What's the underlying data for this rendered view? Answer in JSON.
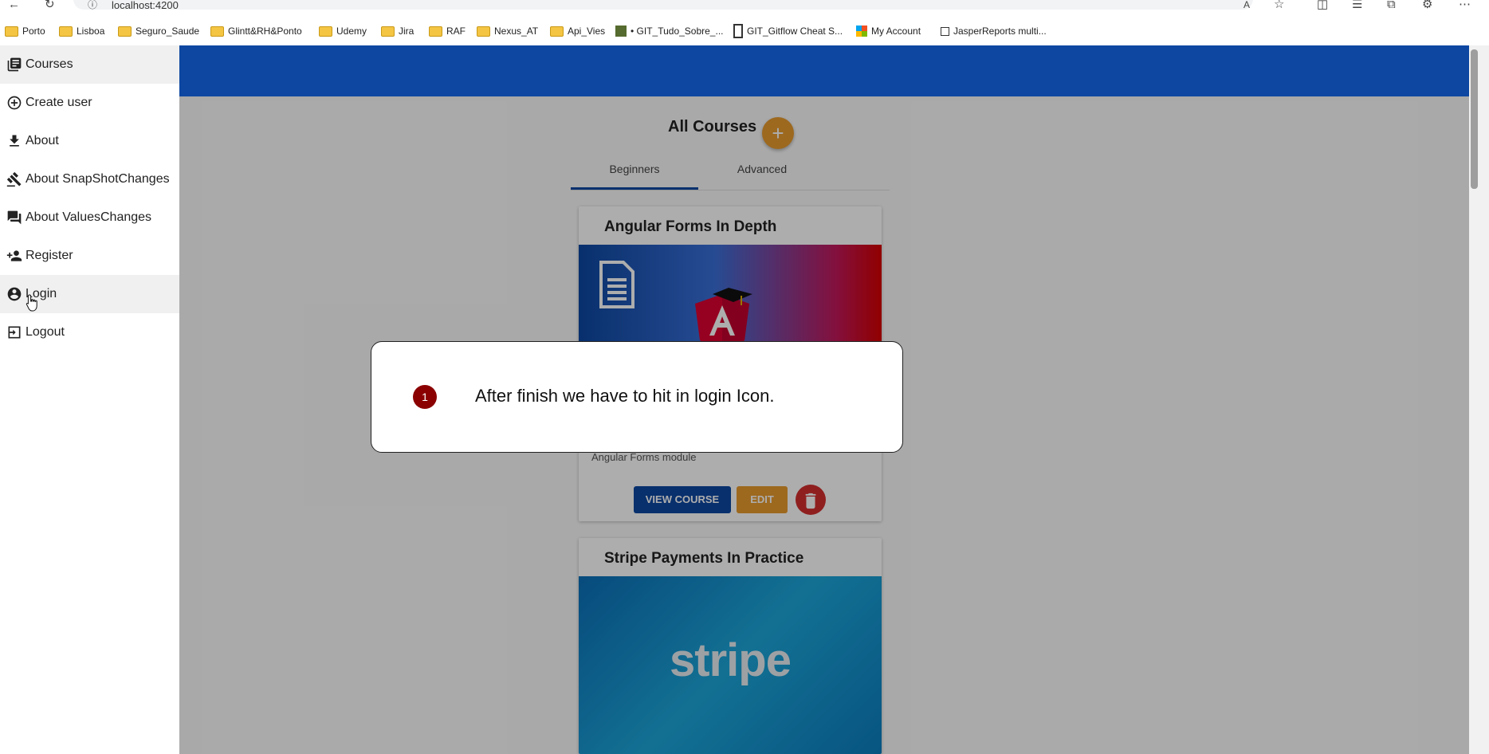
{
  "browser": {
    "url": "localhost:4200",
    "bookmarks": [
      {
        "label": "Porto",
        "kind": "folder"
      },
      {
        "label": "Lisboa",
        "kind": "folder"
      },
      {
        "label": "Seguro_Saude",
        "kind": "folder"
      },
      {
        "label": "Glintt&RH&Ponto",
        "kind": "folder"
      },
      {
        "label": "Udemy",
        "kind": "folder"
      },
      {
        "label": "Jira",
        "kind": "folder"
      },
      {
        "label": "RAF",
        "kind": "folder"
      },
      {
        "label": "Nexus_AT",
        "kind": "folder"
      },
      {
        "label": "Api_Vies",
        "kind": "folder"
      },
      {
        "label": "• GIT_Tudo_Sobre_...",
        "kind": "page"
      },
      {
        "label": "GIT_Gitflow Cheat S...",
        "kind": "page"
      },
      {
        "label": "My Account",
        "kind": "page"
      },
      {
        "label": "JasperReports multi...",
        "kind": "page"
      }
    ]
  },
  "sidebar": {
    "items": [
      {
        "label": "Courses",
        "icon": "library-books-icon"
      },
      {
        "label": "Create user",
        "icon": "add-circle-icon"
      },
      {
        "label": "About",
        "icon": "download-icon"
      },
      {
        "label": "About SnapShotChanges",
        "icon": "gavel-icon"
      },
      {
        "label": "About ValuesChanges",
        "icon": "forum-icon"
      },
      {
        "label": "Register",
        "icon": "person-add-icon"
      },
      {
        "label": "Login",
        "icon": "account-circle-icon"
      },
      {
        "label": "Logout",
        "icon": "exit-icon"
      }
    ]
  },
  "main": {
    "title": "All Courses",
    "add_button": "+",
    "tabs": [
      {
        "label": "Beginners",
        "active": true
      },
      {
        "label": "Advanced",
        "active": false
      }
    ],
    "courses": [
      {
        "title": "Angular Forms In Depth",
        "description": "Angular Forms module",
        "view_label": "VIEW COURSE",
        "edit_label": "EDIT"
      },
      {
        "title": "Stripe Payments In Practice",
        "image_text": "stripe"
      }
    ]
  },
  "callout": {
    "number": "1",
    "text": "After finish we have to hit in login Icon."
  },
  "colors": {
    "primary": "#0d47a1",
    "accent": "#e89b2f",
    "warn": "#d32f2f",
    "callout_badge": "#8b0000"
  }
}
